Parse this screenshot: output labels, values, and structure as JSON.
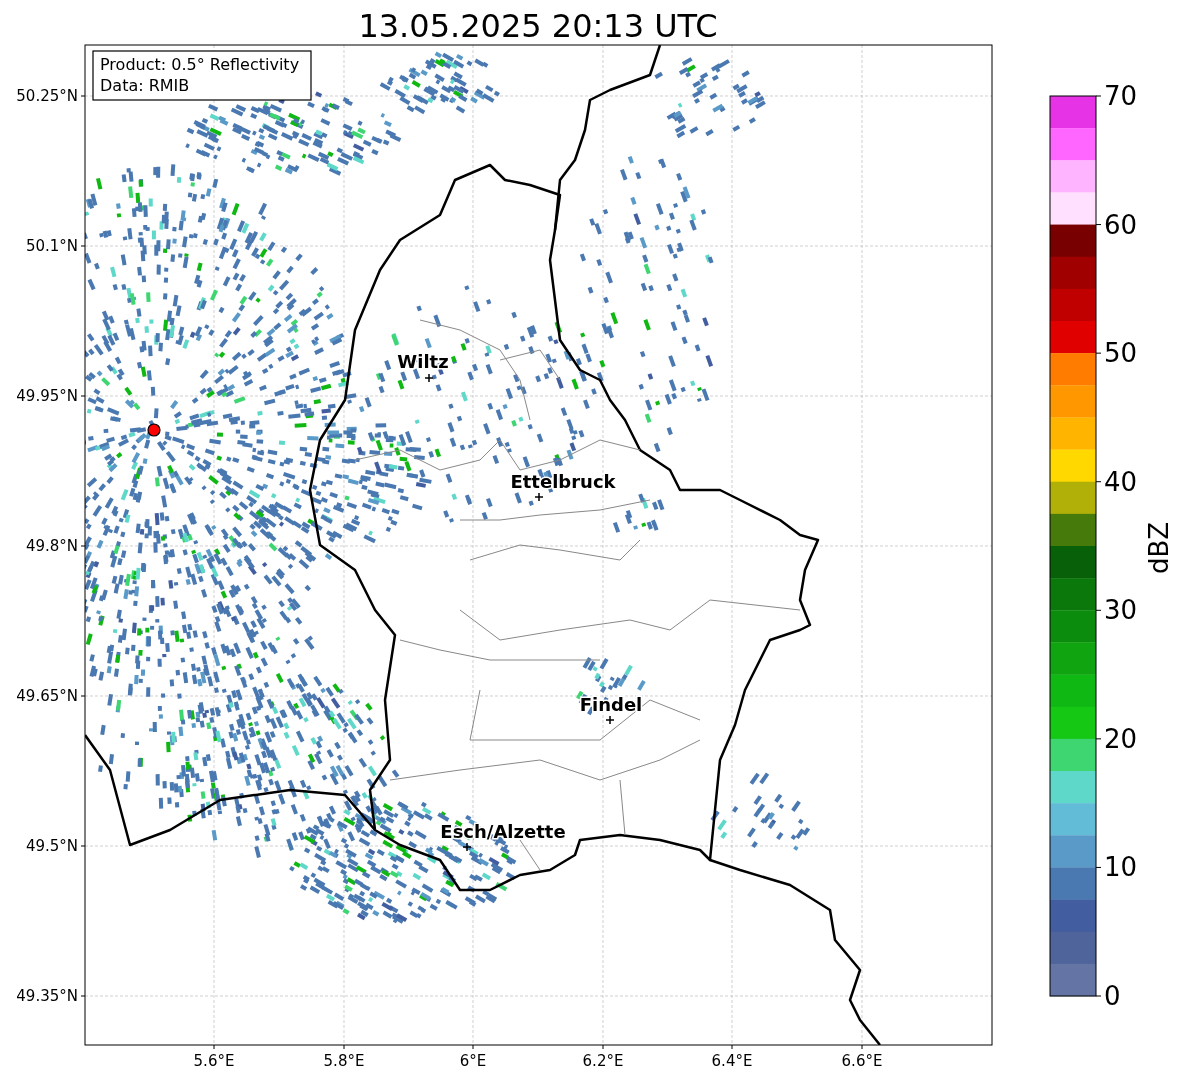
{
  "title": "13.05.2025 20:13 UTC",
  "info_box": [
    "Product: 0.5° Reflectivity",
    "Data: RMIB"
  ],
  "lat_ticks": [
    "50.25°N",
    "50.1°N",
    "49.95°N",
    "49.8°N",
    "49.65°N",
    "49.5°N",
    "49.35°N"
  ],
  "lon_ticks": [
    "5.6°E",
    "5.8°E",
    "6°E",
    "6.2°E",
    "6.4°E",
    "6.6°E"
  ],
  "cities": [
    {
      "name": "Wiltz"
    },
    {
      "name": "Ettelbruck"
    },
    {
      "name": "Findel"
    },
    {
      "name": "Esch/Alzette"
    }
  ],
  "colorbar": {
    "label": "dBZ",
    "ticks": [
      "70",
      "60",
      "50",
      "40",
      "30",
      "20",
      "10",
      "0"
    ],
    "levels": [
      {
        "color": "#e633e6"
      },
      {
        "color": "#ff66ff"
      },
      {
        "color": "#ffb4ff"
      },
      {
        "color": "#ffe0ff"
      },
      {
        "color": "#780000"
      },
      {
        "color": "#a00000"
      },
      {
        "color": "#c00000"
      },
      {
        "color": "#e00000"
      },
      {
        "color": "#ff7c00"
      },
      {
        "color": "#ff9800"
      },
      {
        "color": "#ffb400"
      },
      {
        "color": "#ffd800"
      },
      {
        "color": "#b0b008"
      },
      {
        "color": "#467a0a"
      },
      {
        "color": "#086008"
      },
      {
        "color": "#0a780a"
      },
      {
        "color": "#0c8c0c"
      },
      {
        "color": "#10a410"
      },
      {
        "color": "#10b814"
      },
      {
        "color": "#14c814"
      },
      {
        "color": "#3ed670"
      },
      {
        "color": "#5ed8c8"
      },
      {
        "color": "#62bcd8"
      },
      {
        "color": "#5a9ac8"
      },
      {
        "color": "#4a78b0"
      },
      {
        "color": "#425ea0"
      },
      {
        "color": "#50649c"
      },
      {
        "color": "#6474a4"
      }
    ]
  }
}
